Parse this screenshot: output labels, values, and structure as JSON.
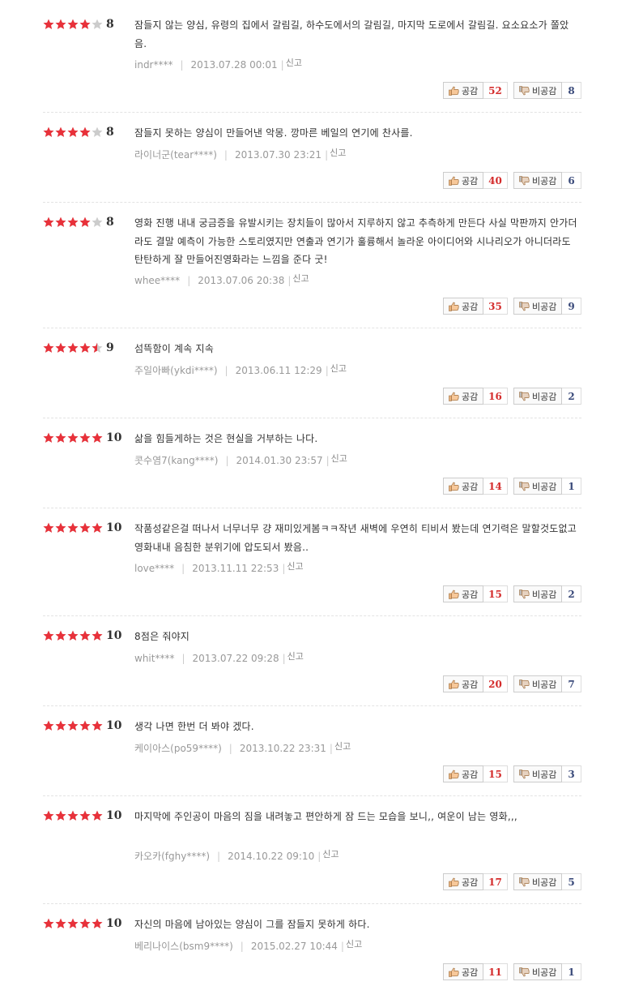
{
  "colors": {
    "star_on": "#e8313a",
    "star_off": "#cccccc",
    "like_count": "#d42c2c",
    "dislike_count": "#3a4a7a"
  },
  "labels": {
    "like": "공감",
    "dislike": "비공감",
    "report": "신고"
  },
  "reviews": [
    {
      "rating_stars": 4,
      "score": "8",
      "text": "잠들지 않는 양심, 유령의 집에서 갈림길, 하수도에서의 갈림길, 마지막 도로에서 갈림길. 요소요소가 쫄았음.",
      "author": "indr****",
      "date": "2013.07.28 00:01",
      "likes": "52",
      "dislikes": "8"
    },
    {
      "rating_stars": 4,
      "score": "8",
      "text": "잠들지 못하는 양심이 만들어낸 악몽. 깡마른 베일의 연기에 찬사를.",
      "author": "라이너군(tear****)",
      "date": "2013.07.30 23:21",
      "likes": "40",
      "dislikes": "6"
    },
    {
      "rating_stars": 4,
      "score": "8",
      "text": "영화 진행 내내 궁금증을 유발시키는 장치들이 많아서 지루하지 않고 추측하게 만든다 사실 막판까지 안가더라도 결말 예측이 가능한 스토리였지만 연출과 연기가 훌륭해서 놀라운 아이디어와 시나리오가 아니더라도 탄탄하게 잘 만들어진영화라는 느낌을 준다 굿!",
      "author": "whee****",
      "date": "2013.07.06 20:38",
      "likes": "35",
      "dislikes": "9"
    },
    {
      "rating_stars": 4.5,
      "score": "9",
      "text": "섬뜩함이 계속 지속",
      "author": "주일아빠(ykdi****)",
      "date": "2013.06.11 12:29",
      "likes": "16",
      "dislikes": "2"
    },
    {
      "rating_stars": 5,
      "score": "10",
      "text": "삶을 힘들게하는 것은 현실을 거부하는 나다.",
      "author": "콧수염7(kang****)",
      "date": "2014.01.30 23:57",
      "likes": "14",
      "dislikes": "1"
    },
    {
      "rating_stars": 5,
      "score": "10",
      "text": "작품성같은걸 떠나서 너무너무 걍 재미있게봄ㅋㅋ작년 새벽에 우연히 티비서 봤는데 연기력은 말할것도없고 영화내내 음침한 분위기에 압도되서 봤음..",
      "author": "love****",
      "date": "2013.11.11 22:53",
      "likes": "15",
      "dislikes": "2"
    },
    {
      "rating_stars": 5,
      "score": "10",
      "text": "8점은 줘야지",
      "author": "whit****",
      "date": "2013.07.22 09:28",
      "likes": "20",
      "dislikes": "7"
    },
    {
      "rating_stars": 5,
      "score": "10",
      "text": "생각 나면 한번 더 봐야 겠다.",
      "author": "케이아스(po59****)",
      "date": "2013.10.22 23:31",
      "likes": "15",
      "dislikes": "3"
    },
    {
      "rating_stars": 5,
      "score": "10",
      "text": "마지막에 주인공이 마음의 짐을 내려놓고 편안하게 잠 드는 모습을 보니,, 여운이 남는 영화,,,",
      "author": "카오카(fghy****)",
      "date": "2014.10.22 09:10",
      "likes": "17",
      "dislikes": "5"
    },
    {
      "rating_stars": 5,
      "score": "10",
      "text": "자신의 마음에 남아있는 양심이 그를 잠들지 못하게 하다.",
      "author": "베리나이스(bsm9****)",
      "date": "2015.02.27 10:44",
      "likes": "11",
      "dislikes": "1"
    }
  ]
}
